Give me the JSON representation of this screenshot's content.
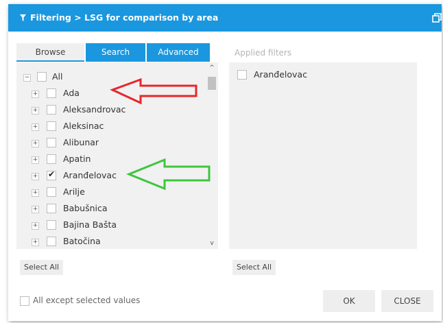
{
  "dialog": {
    "title": "Filtering > LSG for comparison by area",
    "tabs": [
      "Browse",
      "Search",
      "Advanced"
    ],
    "tree": {
      "root": "All",
      "items": [
        {
          "label": "Ada",
          "checked": false
        },
        {
          "label": "Aleksandrovac",
          "checked": false
        },
        {
          "label": "Aleksinac",
          "checked": false
        },
        {
          "label": "Alibunar",
          "checked": false
        },
        {
          "label": "Apatin",
          "checked": false
        },
        {
          "label": "Aranđelovac",
          "checked": true
        },
        {
          "label": "Arilje",
          "checked": false
        },
        {
          "label": "Babušnica",
          "checked": false
        },
        {
          "label": "Bajina Bašta",
          "checked": false
        },
        {
          "label": "Batočina",
          "checked": false
        }
      ]
    },
    "applied": {
      "title": "Applied filters",
      "items": [
        "Aranđelovac"
      ]
    },
    "select_all_left": "Select All",
    "select_all_right": "Select All",
    "except_label": "All except selected values",
    "ok_label": "OK",
    "close_label": "CLOSE",
    "annotations": {
      "red_arrow_color": "#e8262a",
      "green_arrow_color": "#3dc63d"
    },
    "colors": {
      "accent": "#1a97df"
    }
  }
}
